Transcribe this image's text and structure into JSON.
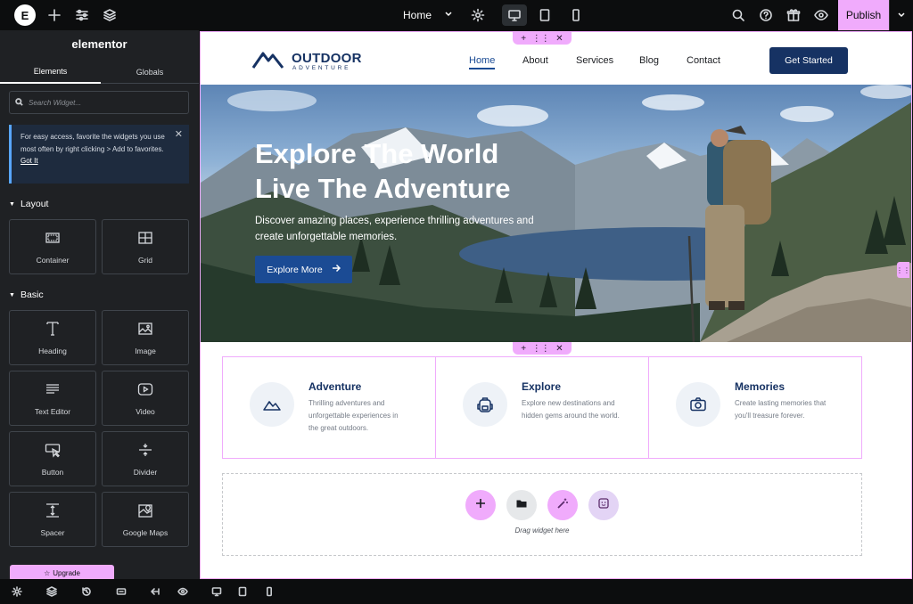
{
  "topbar": {
    "logo_text": "E",
    "page_name": "Home",
    "publish_label": "Publish",
    "icons": [
      "add-icon",
      "sliders-icon",
      "layers-icon",
      "gear-icon",
      "desktop-icon",
      "tablet-icon",
      "mobile-icon",
      "search-icon",
      "help-icon",
      "gift-icon",
      "eye-icon",
      "chevron-down-icon"
    ]
  },
  "sidebar": {
    "title": "elementor",
    "tabs": [
      "Elements",
      "Globals"
    ],
    "search_placeholder": "Search Widget...",
    "notice_text": "For easy access, favorite the widgets you use most often by right clicking > Add to favorites.",
    "notice_link": "Got It",
    "categories": [
      {
        "name": "Layout",
        "widgets": [
          "Container",
          "Grid"
        ]
      },
      {
        "name": "Basic",
        "widgets": [
          "Heading",
          "Image",
          "Text Editor",
          "Video",
          "Button",
          "Divider",
          "Spacer",
          "Google Maps"
        ]
      }
    ],
    "upgrade_label": "Upgrade"
  },
  "site": {
    "brand_name": "OUTDOOR",
    "brand_sub": "ADVENTURE",
    "nav": [
      "Home",
      "About",
      "Services",
      "Blog",
      "Contact"
    ],
    "active_nav": "Home",
    "cta": "Get Started",
    "hero": {
      "title_line1": "Explore The World",
      "title_line2": "Live The Adventure",
      "subtitle": "Discover amazing places, experience thrilling adventures and create unforgettable memories.",
      "button": "Explore More"
    },
    "features": [
      {
        "title": "Adventure",
        "desc": "Thrilling adventures and unforgettable experiences in the great outdoors.",
        "icon": "mountain-icon"
      },
      {
        "title": "Explore",
        "desc": "Explore new destinations and hidden gems around the world.",
        "icon": "backpack-icon"
      },
      {
        "title": "Memories",
        "desc": "Create lasting memories that you'll treasure forever.",
        "icon": "camera-icon"
      }
    ],
    "dropzone_label": "Drag widget here"
  },
  "colors": {
    "accent_pink": "#f0abfc",
    "brand_navy": "#163263",
    "brand_blue": "#1b4b94",
    "panel_bg": "#1f2124",
    "topbar_bg": "#0c0d0e"
  }
}
